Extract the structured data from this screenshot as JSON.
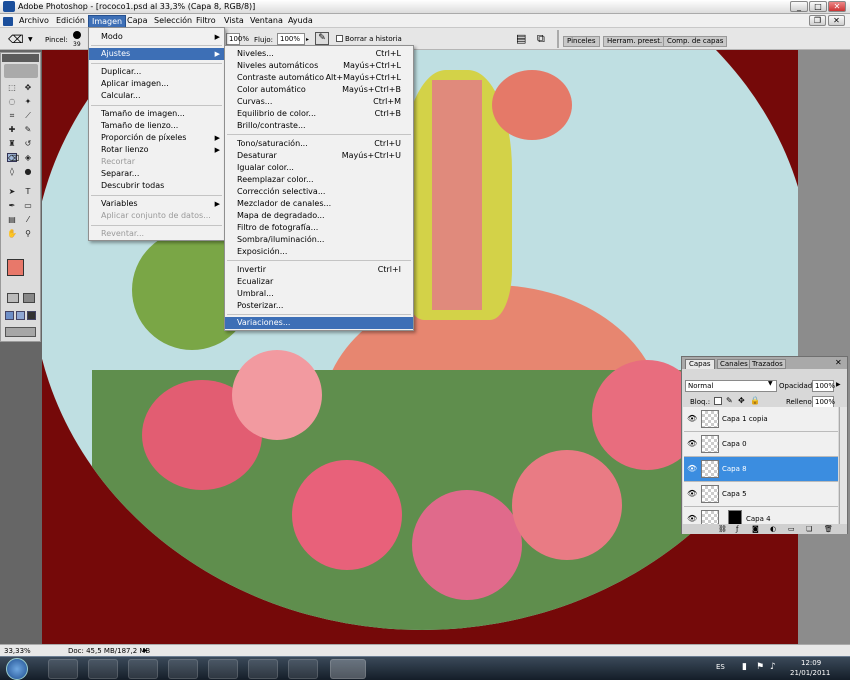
{
  "window": {
    "title": "Adobe Photoshop - [rococo1.psd al 33,3% (Capa 8, RGB/8)]",
    "min": "_",
    "max": "□",
    "close": "✕"
  },
  "menubar": [
    "Archivo",
    "Edición",
    "Imagen",
    "Capa",
    "Selección",
    "Filtro",
    "Vista",
    "Ventana",
    "Ayuda"
  ],
  "options": {
    "brush_label": "Pincel:",
    "brush_size": "39",
    "opacity_value": "100%",
    "flow_label": "Flujo:",
    "flow_value": "100%",
    "history_label": "Borrar a historia",
    "tabs": [
      "Pinceles",
      "Herram. preest.",
      "Comp. de capas"
    ]
  },
  "imagen_menu": [
    {
      "label": "Modo",
      "arrow": true
    },
    {
      "label": "Ajustes",
      "arrow": true,
      "highlight": true
    },
    {
      "label": "Duplicar..."
    },
    {
      "label": "Aplicar imagen..."
    },
    {
      "label": "Calcular..."
    },
    {
      "label": "Tamaño de imagen..."
    },
    {
      "label": "Tamaño de lienzo..."
    },
    {
      "label": "Proporción de píxeles",
      "arrow": true
    },
    {
      "label": "Rotar lienzo",
      "arrow": true
    },
    {
      "label": "Recortar",
      "disabled": true
    },
    {
      "label": "Separar..."
    },
    {
      "label": "Descubrir todas"
    },
    {
      "label": "Variables",
      "arrow": true
    },
    {
      "label": "Aplicar conjunto de datos...",
      "disabled": true
    },
    {
      "label": "Reventar...",
      "disabled": true
    }
  ],
  "ajustes_menu": [
    {
      "label": "Niveles...",
      "shortcut": "Ctrl+L"
    },
    {
      "label": "Niveles automáticos",
      "shortcut": "Mayús+Ctrl+L"
    },
    {
      "label": "Contraste automático",
      "shortcut": "Alt+Mayús+Ctrl+L"
    },
    {
      "label": "Color automático",
      "shortcut": "Mayús+Ctrl+B"
    },
    {
      "label": "Curvas...",
      "shortcut": "Ctrl+M"
    },
    {
      "label": "Equilibrio de color...",
      "shortcut": "Ctrl+B"
    },
    {
      "label": "Brillo/contraste...",
      "shortcut": ""
    },
    {
      "label": "Tono/saturación...",
      "shortcut": "Ctrl+U"
    },
    {
      "label": "Desaturar",
      "shortcut": "Mayús+Ctrl+U"
    },
    {
      "label": "Igualar color...",
      "shortcut": ""
    },
    {
      "label": "Reemplazar color...",
      "shortcut": ""
    },
    {
      "label": "Corrección selectiva...",
      "shortcut": ""
    },
    {
      "label": "Mezclador de canales...",
      "shortcut": ""
    },
    {
      "label": "Mapa de degradado...",
      "shortcut": ""
    },
    {
      "label": "Filtro de fotografía...",
      "shortcut": ""
    },
    {
      "label": "Sombra/iluminación...",
      "shortcut": ""
    },
    {
      "label": "Exposición...",
      "shortcut": ""
    },
    {
      "label": "Invertir",
      "shortcut": "Ctrl+I"
    },
    {
      "label": "Ecualizar",
      "shortcut": ""
    },
    {
      "label": "Umbral...",
      "shortcut": ""
    },
    {
      "label": "Posterizar...",
      "shortcut": ""
    },
    {
      "label": "Variaciones...",
      "shortcut": "",
      "highlight": true
    }
  ],
  "layers_panel": {
    "tabs": [
      "Capas",
      "Canales",
      "Trazados"
    ],
    "blend_mode": "Normal",
    "opacity_label": "Opacidad:",
    "opacity_value": "100%",
    "lock_label": "Bloq.:",
    "fill_label": "Relleno:",
    "fill_value": "100%",
    "layers": [
      {
        "name": "Capa 1 copia"
      },
      {
        "name": "Capa 0"
      },
      {
        "name": "Capa 8",
        "selected": true
      },
      {
        "name": "Capa 5"
      },
      {
        "name": "Capa 4"
      }
    ]
  },
  "status": {
    "zoom": "33,33%",
    "doc": "Doc: 45,5 MB/187,2 MB"
  },
  "taskbar": {
    "lang": "ES",
    "time": "12:09",
    "date": "21/01/2011"
  },
  "colors": {
    "foreground": "#e8786a",
    "background": "#000000",
    "canvas_frame": "#750909",
    "selection": "#3d6fb6"
  }
}
